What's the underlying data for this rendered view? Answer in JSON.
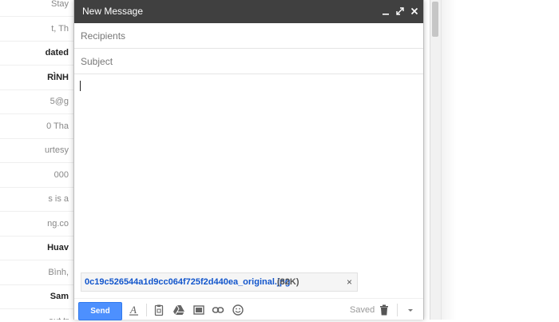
{
  "background_list": [
    {
      "text": "Stay",
      "bold": false
    },
    {
      "text": "t, Th",
      "bold": false
    },
    {
      "text": "dated",
      "bold": true
    },
    {
      "text": "RÌNH",
      "bold": true
    },
    {
      "text": "5@g",
      "bold": false
    },
    {
      "text": "0 Tha",
      "bold": false
    },
    {
      "text": "urtesy",
      "bold": false
    },
    {
      "text": "000 ",
      "bold": false
    },
    {
      "text": "s is a",
      "bold": false
    },
    {
      "text": "ng.co",
      "bold": false
    },
    {
      "text": "Huav",
      "bold": true
    },
    {
      "text": "Bình, ",
      "bold": false
    },
    {
      "text": "Sam",
      "bold": true
    },
    {
      "text": "out tr",
      "bold": false
    }
  ],
  "compose": {
    "title": "New Message",
    "recipients_placeholder": "Recipients",
    "subject_placeholder": "Subject",
    "attachment": {
      "name": "0c19c526544a1d9cc064f725f2d440ea_original.jpg",
      "size": "(82K)",
      "remove_glyph": "×"
    },
    "toolbar": {
      "send_label": "Send",
      "saved_label": "Saved",
      "icons": [
        "formatting-icon",
        "attach-file-icon",
        "drive-icon",
        "insert-photo-icon",
        "insert-link-icon",
        "emoji-icon",
        "trash-icon",
        "more-options-icon"
      ]
    }
  },
  "colors": {
    "titlebar": "#404040",
    "send_button": "#4d90fe",
    "attachment_link": "#1155cc"
  }
}
